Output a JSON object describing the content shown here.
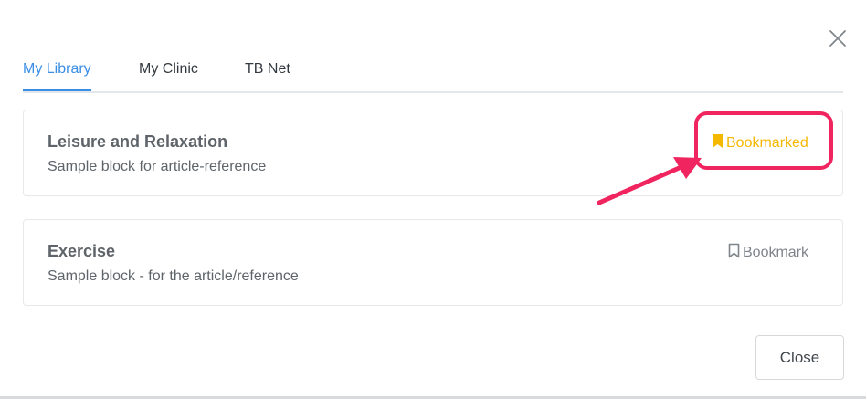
{
  "tabs": [
    {
      "label": "My Library",
      "active": true
    },
    {
      "label": "My Clinic",
      "active": false
    },
    {
      "label": "TB Net",
      "active": false
    }
  ],
  "cards": [
    {
      "title": "Leisure and Relaxation",
      "subtitle": "Sample block for article-reference",
      "bookmark_label": "Bookmarked",
      "bookmarked": true,
      "bookmark_icon": "bookmark-filled-icon"
    },
    {
      "title": "Exercise",
      "subtitle": "Sample block - for the article/reference",
      "bookmark_label": "Bookmark",
      "bookmarked": false,
      "bookmark_icon": "bookmark-outline-icon"
    }
  ],
  "footer": {
    "close_label": "Close"
  },
  "icons": {
    "dismiss": "close-icon"
  },
  "colors": {
    "accent": "#3a8ee6",
    "bookmarked": "#f5b800",
    "annotation": "#f0245f"
  }
}
